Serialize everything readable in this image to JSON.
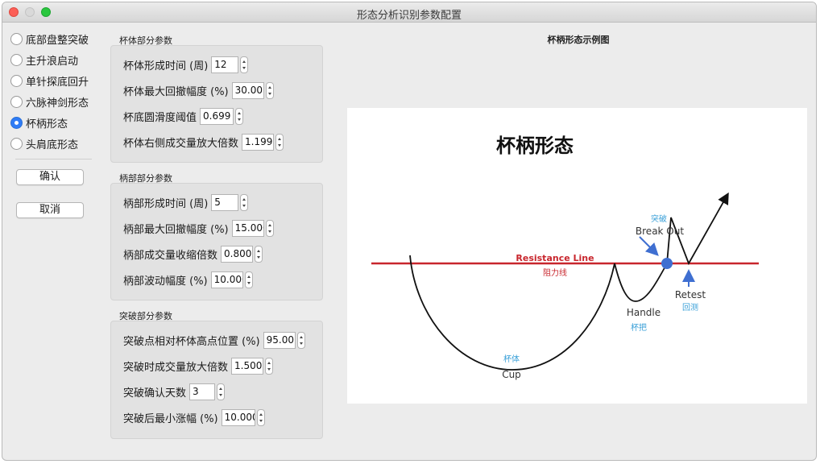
{
  "window": {
    "title": "形态分析识别参数配置"
  },
  "patterns": {
    "items": [
      {
        "label": "底部盘整突破",
        "selected": false
      },
      {
        "label": "主升浪启动",
        "selected": false
      },
      {
        "label": "单针探底回升",
        "selected": false
      },
      {
        "label": "六脉神剑形态",
        "selected": false
      },
      {
        "label": "杯柄形态",
        "selected": true
      },
      {
        "label": "头肩底形态",
        "selected": false
      }
    ]
  },
  "buttons": {
    "ok": "确认",
    "cancel": "取消"
  },
  "cup_group": {
    "title": "杯体部分参数",
    "fields": [
      {
        "label": "杯体形成时间 (周)",
        "value": "12"
      },
      {
        "label": "杯体最大回撤幅度 (%)",
        "value": "30.00"
      },
      {
        "label": "杯底圆滑度阈值",
        "value": "0.699"
      },
      {
        "label": "杯体右侧成交量放大倍数",
        "value": "1.1999"
      }
    ]
  },
  "handle_group": {
    "title": "柄部部分参数",
    "fields": [
      {
        "label": "柄部形成时间 (周)",
        "value": "5"
      },
      {
        "label": "柄部最大回撤幅度 (%)",
        "value": "15.000"
      },
      {
        "label": "柄部成交量收缩倍数",
        "value": "0.800"
      },
      {
        "label": "柄部波动幅度 (%)",
        "value": "10.000"
      }
    ]
  },
  "breakout_group": {
    "title": "突破部分参数",
    "fields": [
      {
        "label": "突破点相对杯体高点位置 (%)",
        "value": "95.00"
      },
      {
        "label": "突破时成交量放大倍数",
        "value": "1.5000"
      },
      {
        "label": "突破确认天数",
        "value": "3"
      },
      {
        "label": "突破后最小涨幅 (%)",
        "value": "10.000"
      }
    ]
  },
  "diagram": {
    "panel_title": "杯柄形态示例图",
    "heading": "杯柄形态",
    "resistance_en": "Resistance Line",
    "resistance_cn": "阻力线",
    "breakout_cn": "突破",
    "breakout_en": "Break Out",
    "handle_en": "Handle",
    "handle_cn": "杯把",
    "retest_en": "Retest",
    "retest_cn": "回测",
    "cup_cn": "杯体",
    "cup_en": "Cup",
    "colors": {
      "resistance": "#c8262d",
      "accent_blue": "#3aa0d8",
      "point": "#3f6fd1"
    }
  }
}
